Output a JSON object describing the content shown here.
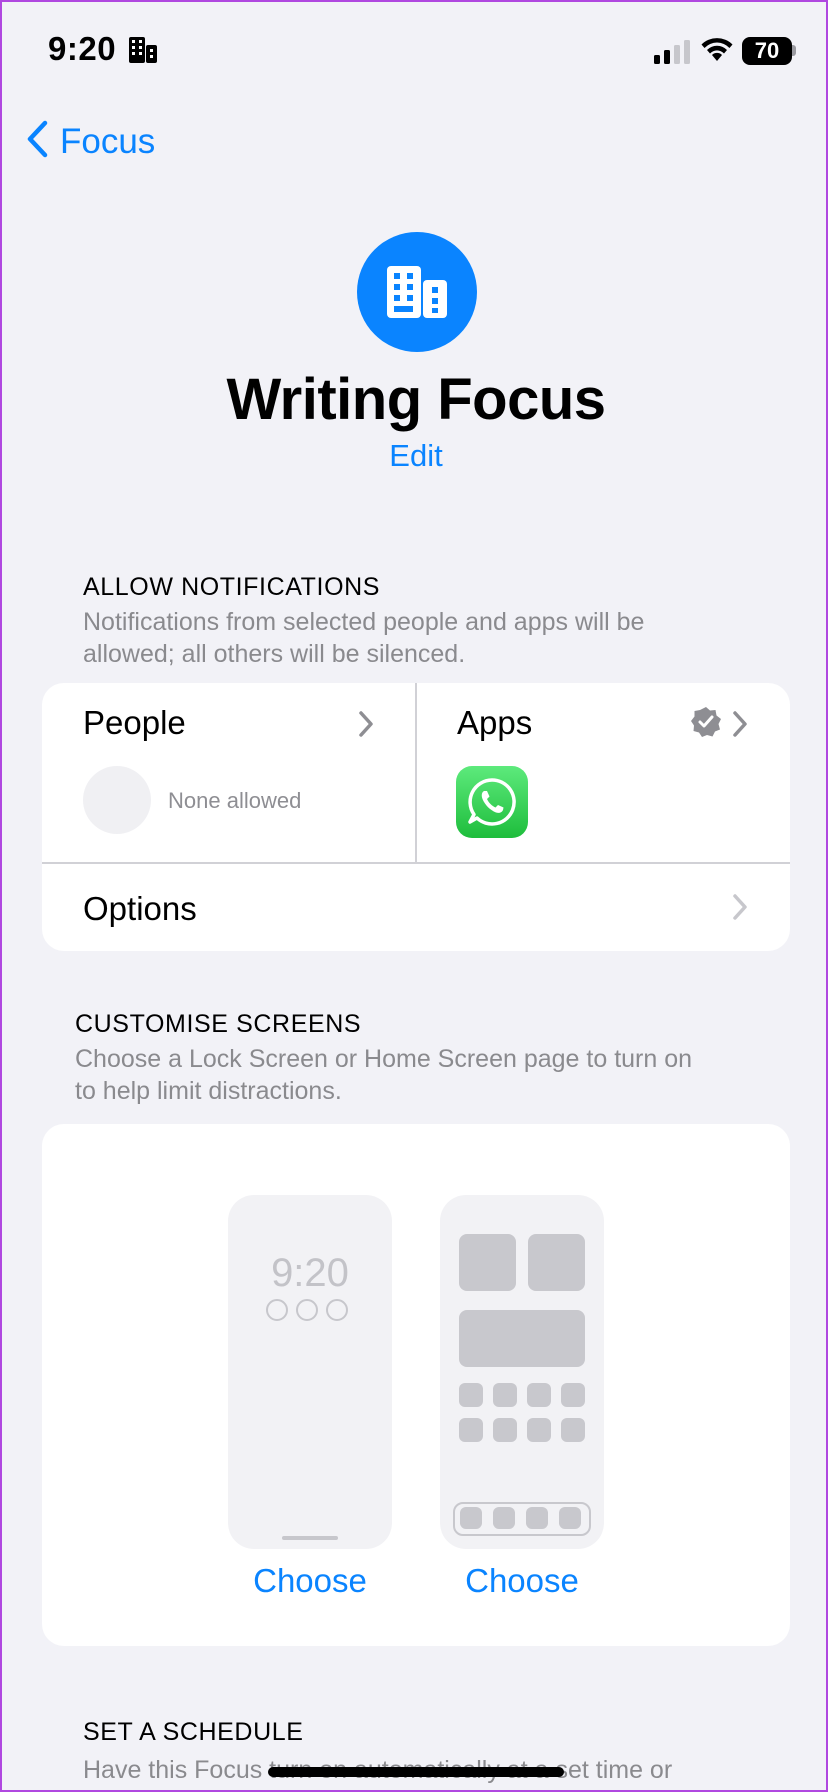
{
  "status_bar": {
    "time": "9:20",
    "battery": "70",
    "icons": [
      "building-icon",
      "signal-icon",
      "wifi-icon",
      "battery-icon"
    ]
  },
  "nav": {
    "back_label": "Focus",
    "back_icon": "chevron-left-icon"
  },
  "focus": {
    "icon": "building-icon",
    "accent_color": "#0a84ff",
    "title": "Writing Focus",
    "edit_label": "Edit"
  },
  "allow_notifications": {
    "heading": "ALLOW NOTIFICATIONS",
    "description_line1": "Notifications from selected people and apps will be",
    "description_line2": "allowed; all others will be silenced.",
    "people": {
      "label": "People",
      "value": "None allowed"
    },
    "apps": {
      "label": "Apps",
      "badge_icon": "checkmark-seal-icon",
      "app_icons": [
        "whatsapp-icon"
      ]
    },
    "options_label": "Options"
  },
  "customise_screens": {
    "heading": "CUSTOMISE SCREENS",
    "description_line1": "Choose a Lock Screen or Home Screen page to turn on",
    "description_line2": "to help limit distractions.",
    "lock_preview_time": "9:20",
    "lock_choose_label": "Choose",
    "home_choose_label": "Choose"
  },
  "schedule": {
    "heading": "SET A SCHEDULE",
    "description": "Have this Focus turn on automatically at a set time or"
  }
}
